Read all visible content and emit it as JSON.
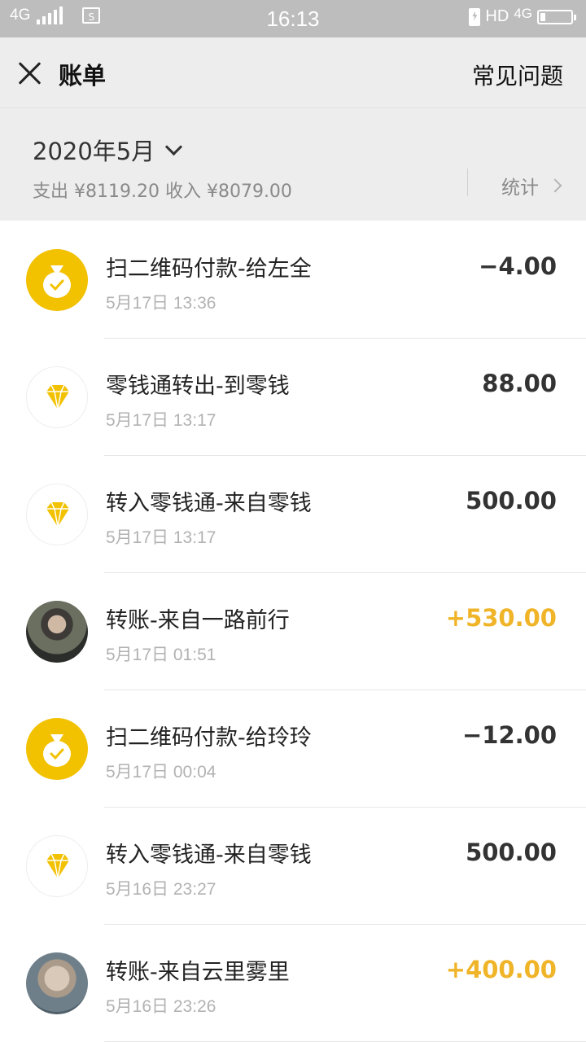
{
  "status_bar": {
    "network": "4G",
    "time": "16:13",
    "hd": "HD",
    "net_right": "4G"
  },
  "header": {
    "title": "账单",
    "faq": "常见问题"
  },
  "summary": {
    "month": "2020年5月",
    "totals": "支出 ¥8119.20 收入 ¥8079.00",
    "stats": "统计"
  },
  "colors": {
    "accent_income": "#f0b429",
    "wallet_yellow": "#f2c100",
    "background_gray": "#ededed"
  },
  "transactions": [
    {
      "icon": "wallet-icon",
      "title": "扫二维码付款-给左全",
      "time": "5月17日 13:36",
      "amount": "−4.00"
    },
    {
      "icon": "diamond-icon",
      "title": "零钱通转出-到零钱",
      "time": "5月17日 13:17",
      "amount": "88.00"
    },
    {
      "icon": "diamond-icon",
      "title": "转入零钱通-来自零钱",
      "time": "5月17日 13:17",
      "amount": "500.00"
    },
    {
      "icon": "avatar",
      "title": "转账-来自一路前行",
      "time": "5月17日 01:51",
      "amount": "+530.00"
    },
    {
      "icon": "wallet-icon",
      "title": "扫二维码付款-给玲玲",
      "time": "5月17日 00:04",
      "amount": "−12.00"
    },
    {
      "icon": "diamond-icon",
      "title": "转入零钱通-来自零钱",
      "time": "5月16日 23:27",
      "amount": "500.00"
    },
    {
      "icon": "avatar",
      "title": "转账-来自云里雾里",
      "time": "5月16日 23:26",
      "amount": "+400.00"
    }
  ]
}
